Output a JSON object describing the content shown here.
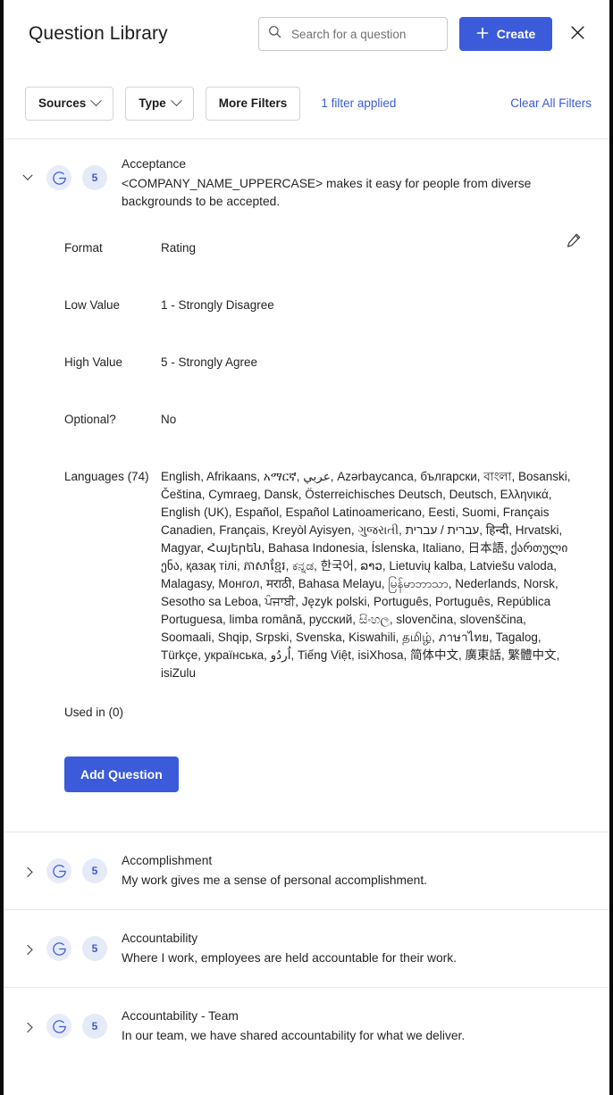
{
  "header": {
    "title": "Question Library",
    "search": {
      "placeholder": "Search for a question",
      "value": "",
      "icon": "search-icon"
    },
    "create_label": "Create",
    "create_icon": "plus-icon",
    "close_icon": "close-icon",
    "accent_color": "#3b5bdb"
  },
  "filter_bar": {
    "sources_label": "Sources",
    "type_label": "Type",
    "more_filters_label": "More Filters",
    "filter_applied_label": "1 filter applied",
    "clear_all_label": "Clear All Filters",
    "link_color": "#3b5bdb"
  },
  "questions": [
    {
      "expanded": true,
      "source_badge": "G",
      "scale_badge": "5",
      "name": "Acceptance",
      "text": "<COMPANY_NAME_UPPERCASE> makes it easy for people from diverse backgrounds to be accepted.",
      "details": {
        "format_label": "Format",
        "format_value": "Rating",
        "low_value_label": "Low Value",
        "low_value_value": "1 - Strongly Disagree",
        "high_value_label": "High Value",
        "high_value_value": "5 - Strongly Agree",
        "optional_label": "Optional?",
        "optional_value": "No",
        "languages_label": "Languages (74)",
        "languages_value": "English, Afrikaans, አማርኛ, عربي, Azərbaycanca, български, বাংলা, Bosanski, Čeština, Cymraeg, Dansk, Österreichisches Deutsch, Deutsch, Ελληνικά, English (UK), Español, Español Latinoamericano, Eesti, Suomi, Français Canadien, Français, Kreyòl Ayisyen, ગુજરાતી, עברית / עברית, हिन्दी, Hrvatski, Magyar, Հայերեն, Bahasa Indonesia, Íslenska, Italiano, 日本語, ქართული ენა, қазақ тілі, ភាសាខ្មែរ, ಕನ್ನಡ, 한국어, ລາວ, Lietuvių kalba, Latviešu valoda, Malagasy, Монгол, मराठी, Bahasa Melayu, မြန်မာဘာသာ, Nederlands, Norsk, Sesotho sa Leboa, ਪੰਜਾਬੀ, Język polski, Português, Português, República Portuguesa, limba română, русский, සිංහල, slovenčina, slovenščina, Soomaali, Shqip, Srpski, Svenska, Kiswahili, தமிழ், ภาษาไทย, Tagalog, Türkçe, українська, اُردُو, Tiếng Việt, isiXhosa, 简体中文, 廣東話, 繁體中文, isiZulu",
        "used_in_label": "Used in (0)",
        "add_question_label": "Add Question",
        "edit_icon": "pencil-icon"
      }
    },
    {
      "expanded": false,
      "source_badge": "G",
      "scale_badge": "5",
      "name": "Accomplishment",
      "text": "My work gives me a sense of personal accomplishment."
    },
    {
      "expanded": false,
      "source_badge": "G",
      "scale_badge": "5",
      "name": "Accountability",
      "text": "Where I work, employees are held accountable for their work."
    },
    {
      "expanded": false,
      "source_badge": "G",
      "scale_badge": "5",
      "name": "Accountability - Team",
      "text": "In our team, we have shared accountability for what we deliver."
    }
  ]
}
